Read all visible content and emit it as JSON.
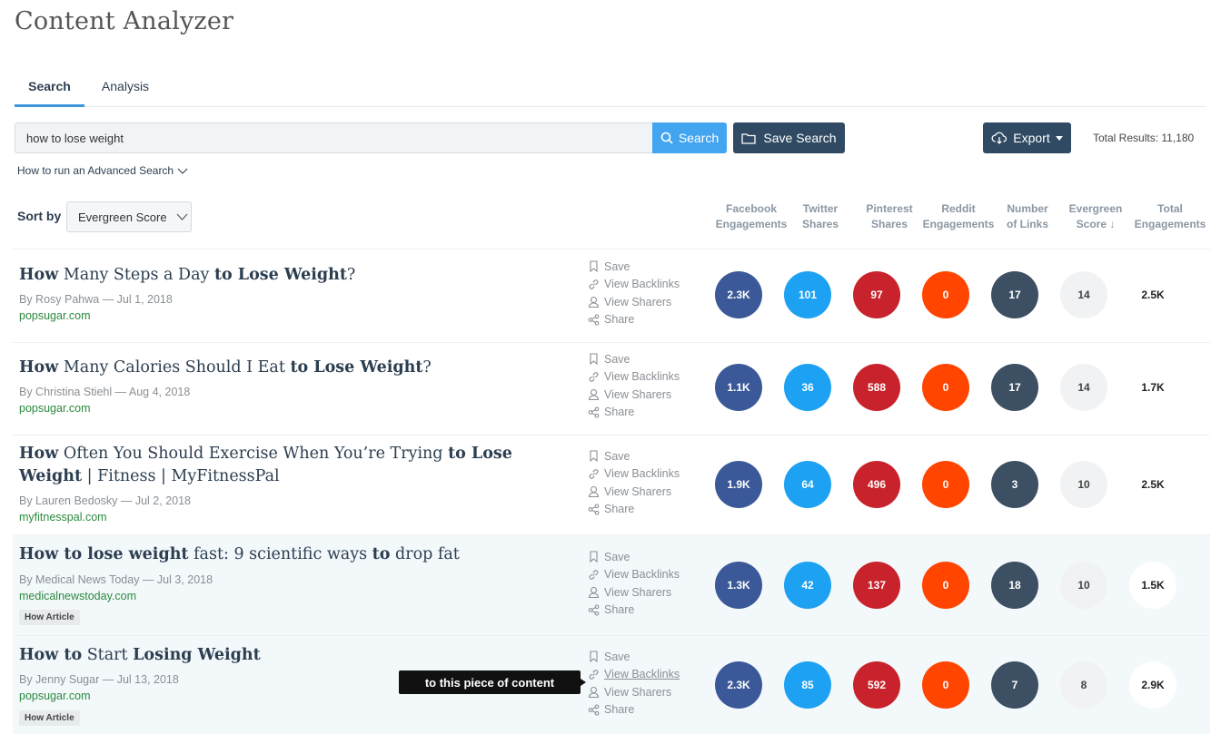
{
  "app": {
    "title": "Content Analyzer"
  },
  "tabs": [
    {
      "label": "Search"
    },
    {
      "label": "Analysis"
    }
  ],
  "search": {
    "value": "how to lose weight",
    "button_label": "Search",
    "save_label": "Save Search",
    "export_label": "Export",
    "total_results": "Total Results: 11,180",
    "advanced_label": "How to run an Advanced Search"
  },
  "sort": {
    "label": "Sort by",
    "selected": "Evergreen Score"
  },
  "columns": [
    {
      "line1": "Facebook",
      "line2": "Engagements"
    },
    {
      "line1": "Twitter",
      "line2": "Shares"
    },
    {
      "line1": "Pinterest",
      "line2": "Shares"
    },
    {
      "line1": "Reddit",
      "line2": "Engagements"
    },
    {
      "line1": "Number",
      "line2": "of Links"
    },
    {
      "line1": "Evergreen",
      "line2": "Score ↓"
    },
    {
      "line1": "Total",
      "line2": "Engagements"
    }
  ],
  "actions": {
    "save": "Save",
    "backlinks": "View Backlinks",
    "sharers": "View Sharers",
    "share": "Share"
  },
  "results": [
    {
      "title_parts": [
        [
          "How",
          true
        ],
        [
          " Many Steps a Day ",
          false
        ],
        [
          "to Lose Weight",
          true
        ],
        [
          "?",
          false
        ]
      ],
      "byline": "By Rosy Pahwa — Jul 1, 2018",
      "domain": "popsugar.com",
      "badge": "",
      "metrics": [
        "2.3K",
        "101",
        "97",
        "0",
        "17",
        "14",
        "2.5K"
      ]
    },
    {
      "title_parts": [
        [
          "How",
          true
        ],
        [
          " Many Calories Should I Eat ",
          false
        ],
        [
          "to Lose Weight",
          true
        ],
        [
          "?",
          false
        ]
      ],
      "byline": "By Christina Stiehl — Aug 4, 2018",
      "domain": "popsugar.com",
      "badge": "",
      "metrics": [
        "1.1K",
        "36",
        "588",
        "0",
        "17",
        "14",
        "1.7K"
      ]
    },
    {
      "title_parts": [
        [
          "How",
          true
        ],
        [
          " Often You Should Exercise When You’re Trying ",
          false
        ],
        [
          "to Lose Weight",
          true
        ],
        [
          " | Fitness | MyFitnessPal",
          false
        ]
      ],
      "byline": "By Lauren Bedosky — Jul 2, 2018",
      "domain": "myfitnesspal.com",
      "badge": "",
      "metrics": [
        "1.9K",
        "64",
        "496",
        "0",
        "3",
        "10",
        "2.5K"
      ]
    },
    {
      "title_parts": [
        [
          "How to lose weight",
          true
        ],
        [
          " fast: 9 scientific ways ",
          false
        ],
        [
          "to",
          true
        ],
        [
          " drop fat",
          false
        ]
      ],
      "byline": "By Medical News Today — Jul 3, 2018",
      "domain": "medicalnewstoday.com",
      "badge": "How Article",
      "metrics": [
        "1.3K",
        "42",
        "137",
        "0",
        "18",
        "10",
        "1.5K"
      ]
    },
    {
      "title_parts": [
        [
          "How to",
          true
        ],
        [
          " Start ",
          false
        ],
        [
          "Losing Weight",
          true
        ]
      ],
      "byline": "By Jenny Sugar — Jul 13, 2018",
      "domain": "popsugar.com",
      "badge": "How Article",
      "metrics": [
        "2.3K",
        "85",
        "592",
        "0",
        "7",
        "8",
        "2.9K"
      ]
    }
  ],
  "tooltip": {
    "text": "to this piece of content"
  }
}
